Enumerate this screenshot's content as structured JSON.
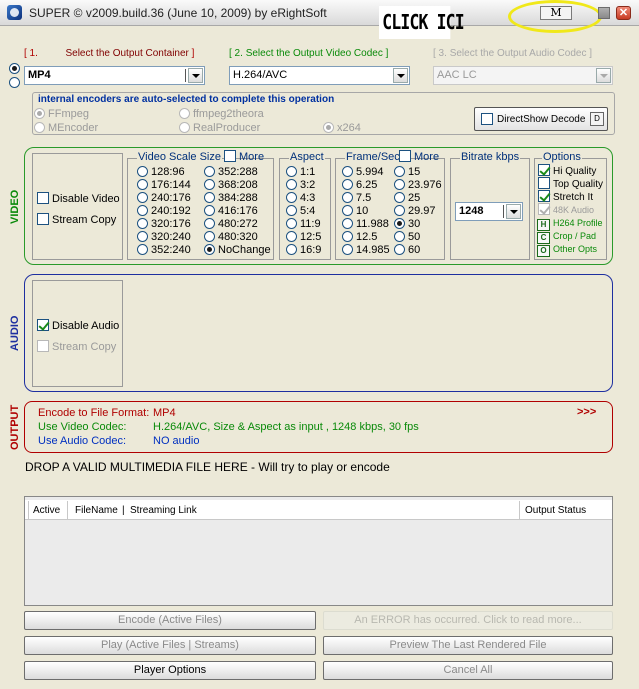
{
  "window": {
    "title": "SUPER © v2009.build.36 (June 10, 2009) by eRightSoft",
    "overlay_text": "CLICK ICI",
    "m_button": "M",
    "close_glyph": "✕"
  },
  "steps": {
    "s1": {
      "open": "[ 1.",
      "label": "Select the Output Container",
      "close": "]"
    },
    "s2": {
      "open": "[ 2.",
      "label": "Select the Output Video Codec",
      "close": "]"
    },
    "s3": {
      "open": "[ 3.",
      "label": "Select the Output Audio Codec",
      "close": "]"
    }
  },
  "selects": {
    "container": "MP4",
    "video_codec": "H.264/AVC",
    "audio_codec": "AAC LC"
  },
  "encoders": {
    "title": "internal encoders are auto-selected to complete this operation",
    "items": [
      "FFmpeg",
      "MEncoder",
      "ffmpeg2theora",
      "RealProducer",
      "x264"
    ],
    "directshow_label": "DirectShow Decode",
    "directshow_btn": "D"
  },
  "video": {
    "side_label": "VIDEO",
    "disable_video": "Disable Video",
    "stream_copy": "Stream Copy",
    "scale_title": "Video Scale Size",
    "scale_more": "More",
    "scale_col1": [
      "128:96",
      "176:144",
      "240:176",
      "240:192",
      "320:176",
      "320:240",
      "352:240"
    ],
    "scale_col2": [
      "352:288",
      "368:208",
      "384:288",
      "416:176",
      "480:272",
      "480:320",
      "NoChange"
    ],
    "aspect_title": "Aspect",
    "aspect": [
      "1:1",
      "3:2",
      "4:3",
      "5:4",
      "11:9",
      "12:5",
      "16:9"
    ],
    "fps_title": "Frame/Sec",
    "fps_more": "More",
    "fps_col1": [
      "5.994",
      "6.25",
      "7.5",
      "10",
      "11.988",
      "12.5",
      "14.985"
    ],
    "fps_col2": [
      "15",
      "23.976",
      "25",
      "29.97",
      "30",
      "50",
      "60"
    ],
    "bitrate_title": "Bitrate  kbps",
    "bitrate_value": "1248",
    "options_title": "Options",
    "options": {
      "hi_quality": "Hi Quality",
      "top_quality": "Top Quality",
      "stretch": "Stretch It",
      "khz": "48K Audio",
      "h264_profile": "H264 Profile",
      "crop_pad": "Crop / Pad",
      "other_opts": "Other Opts",
      "h_btn": "H",
      "c_btn": "C",
      "o_btn": "O"
    }
  },
  "audio": {
    "side_label": "AUDIO",
    "disable_audio": "Disable Audio",
    "stream_copy": "Stream Copy"
  },
  "output": {
    "side_label": "OUTPUT",
    "format_label": "Encode to File Format:",
    "format_value": "MP4",
    "video_label": "Use Video Codec:",
    "video_value": "H.264/AVC,  Size & Aspect as input ,  1248 kbps,  30 fps",
    "audio_label": "Use Audio Codec:",
    "audio_value": "NO audio",
    "more": ">>>"
  },
  "drop_text": "DROP A VALID MULTIMEDIA FILE HERE - Will try to play or encode",
  "file_list": {
    "columns": [
      "Active",
      "FileName",
      "|",
      "Streaming Link",
      "Output Status"
    ]
  },
  "buttons": {
    "encode": "Encode (Active Files)",
    "error": "An ERROR has occurred. Click to read more...",
    "play": "Play (Active Files | Streams)",
    "preview": "Preview The Last Rendered File",
    "player_options": "Player Options",
    "cancel_all": "Cancel All"
  },
  "colors": {
    "video_border": "#2a9a2a",
    "audio_border": "#1e2fa0",
    "output_border": "#b00000",
    "highlight": "#f0e81a"
  }
}
